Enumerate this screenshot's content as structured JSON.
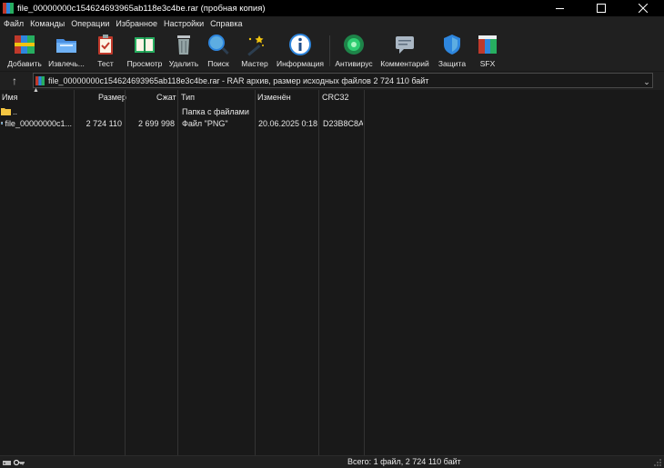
{
  "window": {
    "title": "file_00000000c154624693965ab118e3c4be.rar (пробная копия)"
  },
  "menu": [
    "Файл",
    "Команды",
    "Операции",
    "Избранное",
    "Настройки",
    "Справка"
  ],
  "toolbar": [
    {
      "label": "Добавить",
      "icon": "add-archive-icon"
    },
    {
      "label": "Извлечь...",
      "icon": "extract-folder-icon"
    },
    {
      "label": "Тест",
      "icon": "test-clipboard-icon"
    },
    {
      "label": "Просмотр",
      "icon": "view-book-icon"
    },
    {
      "label": "Удалить",
      "icon": "trash-icon"
    },
    {
      "label": "Поиск",
      "icon": "magnifier-icon"
    },
    {
      "label": "Мастер",
      "icon": "wizard-wand-icon"
    },
    {
      "label": "Информация",
      "icon": "info-icon"
    },
    {
      "label": "Антивирус",
      "icon": "antivirus-icon"
    },
    {
      "label": "Комментарий",
      "icon": "comment-icon"
    },
    {
      "label": "Защита",
      "icon": "shield-icon"
    },
    {
      "label": "SFX",
      "icon": "sfx-icon"
    }
  ],
  "address": {
    "text": "file_00000000c154624693965ab118e3c4be.rar - RAR архив, размер исходных файлов 2 724 110 байт"
  },
  "columns": [
    "Имя",
    "Размер",
    "Сжат",
    "Тип",
    "Изменён",
    "CRC32"
  ],
  "rows": [
    {
      "name": "..",
      "size": "",
      "packed": "",
      "type": "Папка с файлами",
      "modified": "",
      "crc": "",
      "icon": "folder-up-icon"
    },
    {
      "name": "file_00000000c1...",
      "size": "2 724 110",
      "packed": "2 699 998",
      "type": "Файл \"PNG\"",
      "modified": "20.06.2025 0:18",
      "crc": "D23B8C8A",
      "icon": "png-file-icon"
    }
  ],
  "status": {
    "text": "Всего: 1 файл, 2 724 110 байт"
  },
  "colors": {
    "background": "#191919",
    "titlebar": "#000000",
    "toolbar": "#202020",
    "text": "#e6e6e6"
  }
}
